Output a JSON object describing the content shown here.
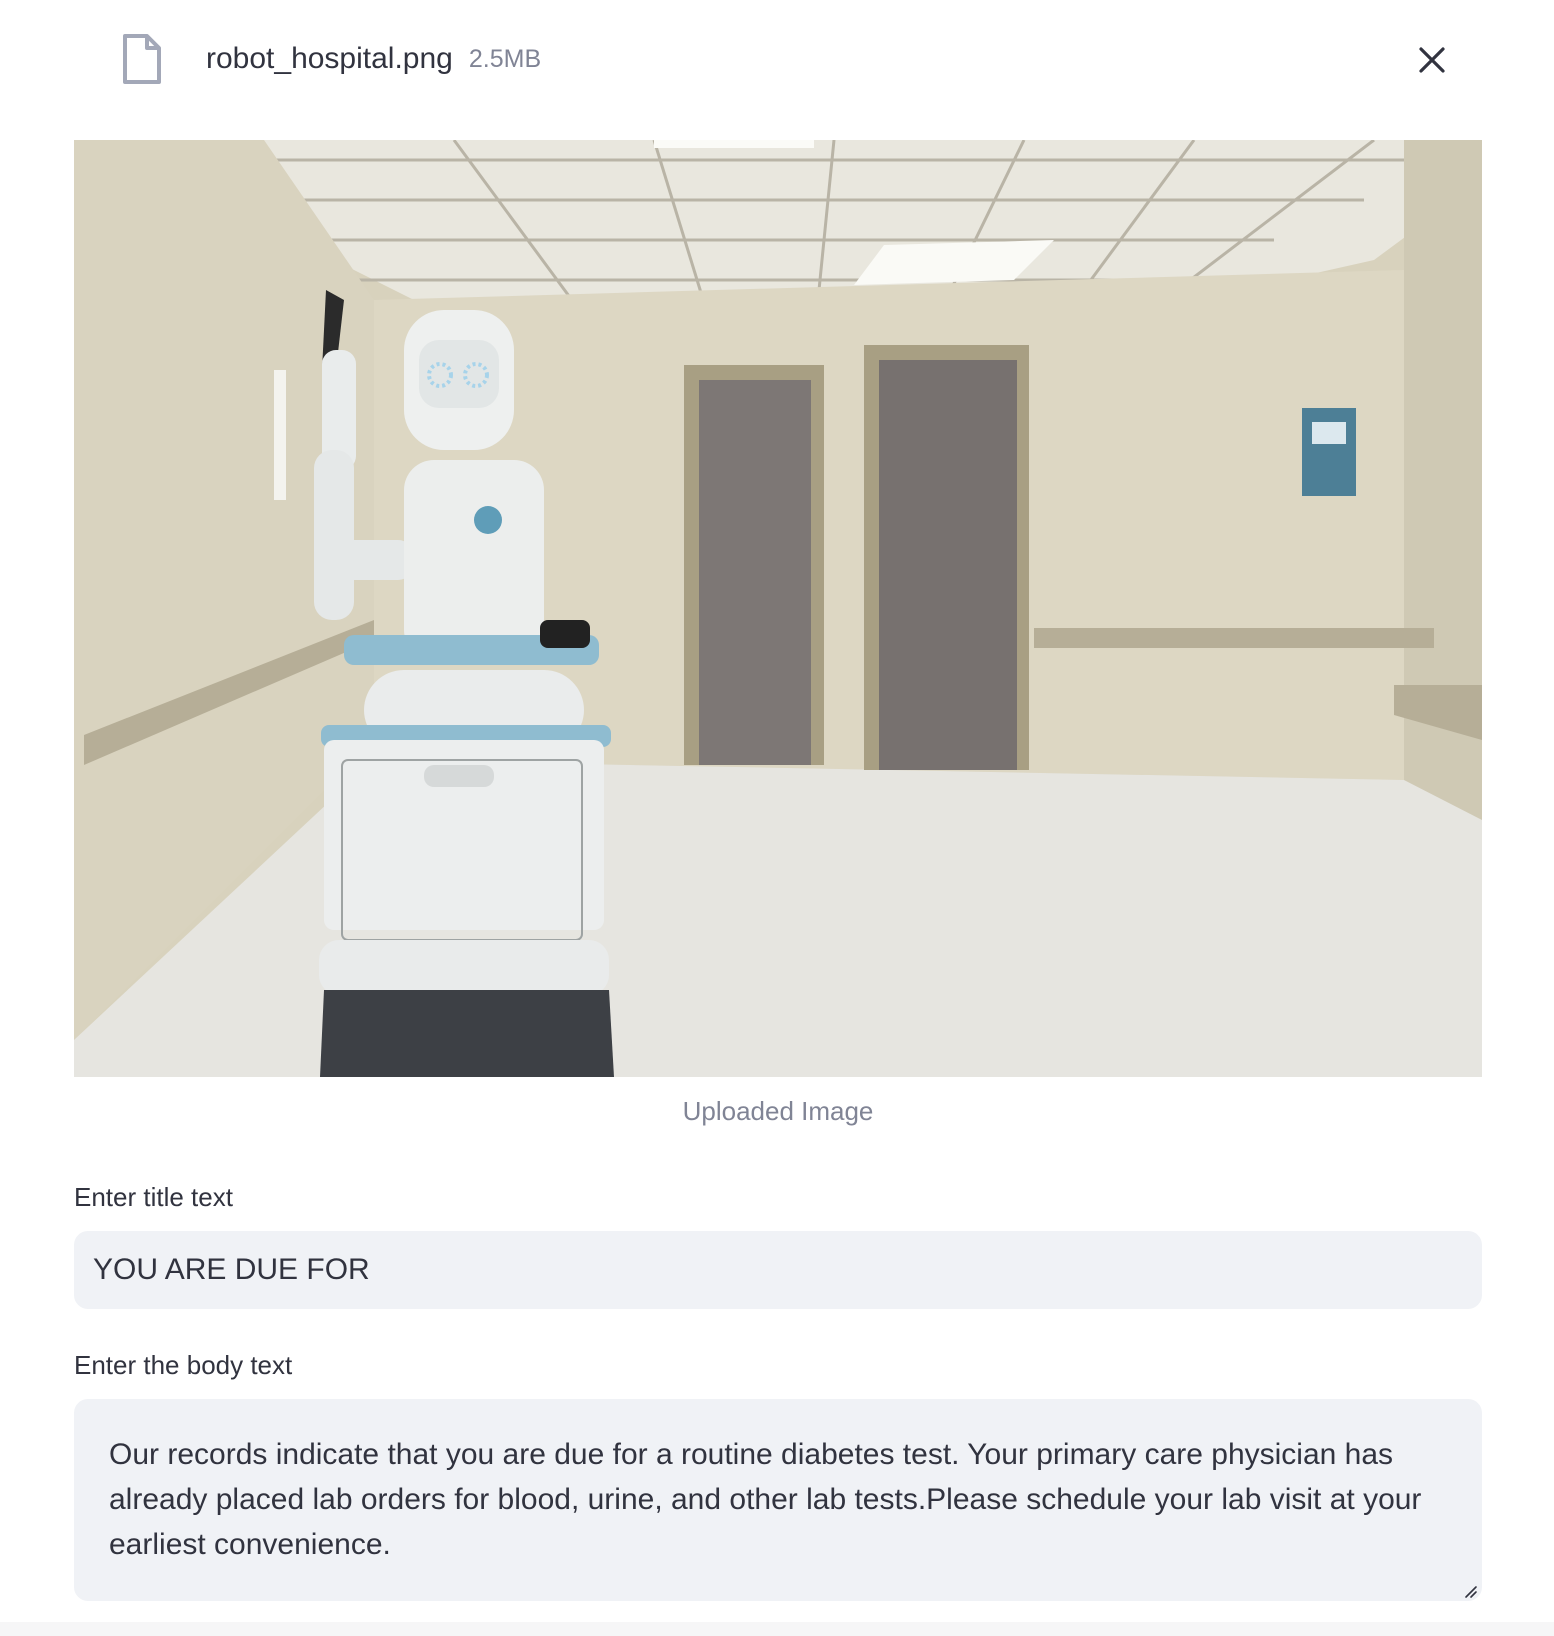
{
  "uploaded_file": {
    "name": "robot_hospital.png",
    "size": "2.5MB",
    "file_icon": "file-icon",
    "close_icon": "close-icon"
  },
  "image": {
    "caption": "Uploaded Image",
    "description_icon": "robot-hospital-photo"
  },
  "title_field": {
    "label": "Enter title text",
    "value": "YOU ARE DUE FOR"
  },
  "body_field": {
    "label": "Enter the body text",
    "value": "Our records indicate that you are due for a routine diabetes test. Your primary care physician has already placed lab orders for blood, urine, and other lab tests.Please schedule your lab visit at your earliest convenience."
  },
  "colors": {
    "text": "#31333f",
    "muted": "#808495",
    "input_bg": "#f0f2f6"
  }
}
